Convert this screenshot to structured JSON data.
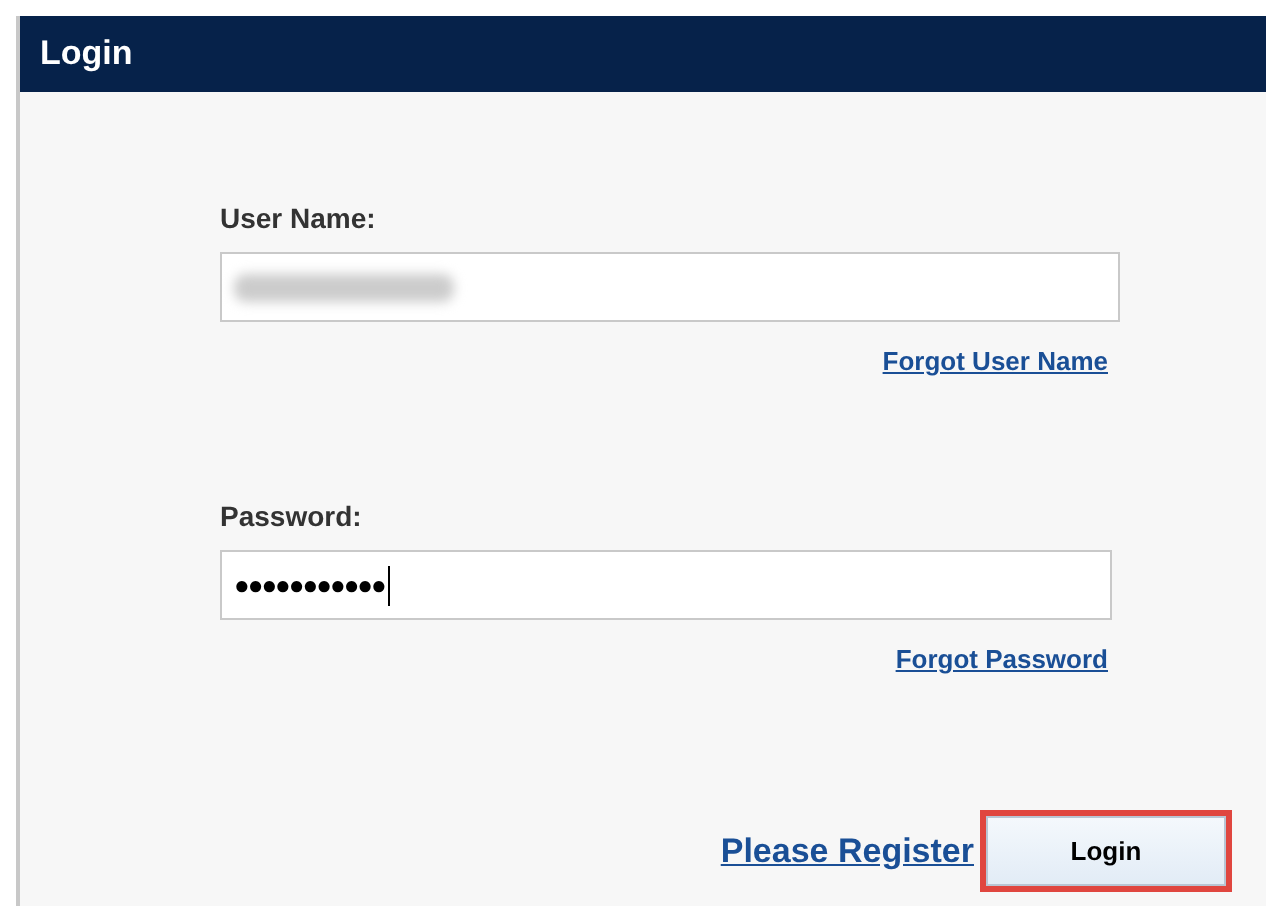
{
  "window": {
    "title": "Login"
  },
  "username": {
    "label": "User Name:",
    "redacted": true,
    "link": "Forgot User Name"
  },
  "password": {
    "label": "Password:",
    "value": "●●●●●●●●●●●",
    "focused": true,
    "link": "Forgot Password"
  },
  "register_link": "Please Register",
  "login_button": {
    "label": "Login",
    "highlighted": true
  }
}
